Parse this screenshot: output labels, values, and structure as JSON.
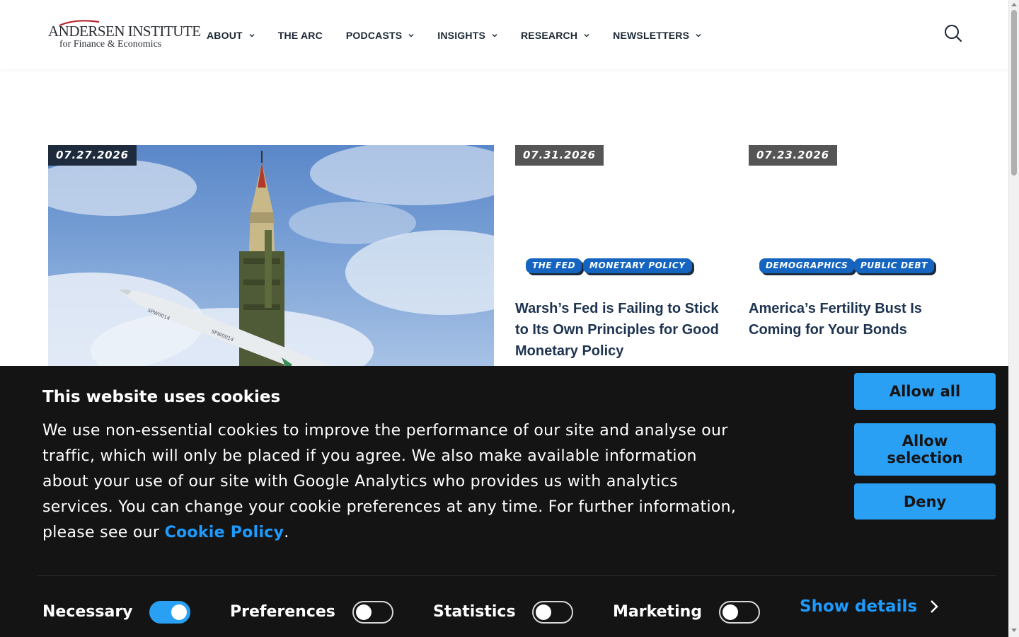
{
  "header": {
    "logo": {
      "top": "ANDERSEN INSTITUTE",
      "bottom": "for Finance & Economics"
    },
    "nav": [
      {
        "label": "ABOUT",
        "has_dropdown": true
      },
      {
        "label": "THE ARC",
        "has_dropdown": false
      },
      {
        "label": "PODCASTS",
        "has_dropdown": true
      },
      {
        "label": "INSIGHTS",
        "has_dropdown": true
      },
      {
        "label": "RESEARCH",
        "has_dropdown": true
      },
      {
        "label": "NEWSLETTERS",
        "has_dropdown": true
      }
    ],
    "search_icon": "search-icon"
  },
  "articles": [
    {
      "date": "07.27.2026",
      "image": "missile-launcher-photo",
      "tags": [],
      "title": ""
    },
    {
      "date": "07.31.2026",
      "tags": [
        "THE FED",
        "MONETARY POLICY"
      ],
      "title": "Warsh’s Fed is Failing to Stick to Its Own Principles for Good Monetary Policy"
    },
    {
      "date": "07.23.2026",
      "tags": [
        "DEMOGRAPHICS",
        "PUBLIC DEBT"
      ],
      "title": "America’s Fertility Bust Is Coming for Your Bonds"
    }
  ],
  "cookie_banner": {
    "title": "This website uses cookies",
    "text_before_link": "We use non-essential cookies to improve the performance of our site and analyse our traffic, which will only be placed if you agree. We also make available information about your use of our site with Google Analytics who provides us with analytics services. You can change your cookie preferences at any time. For further information, please see our ",
    "link_label": "Cookie Policy",
    "text_after_link": ".",
    "buttons": {
      "allow_all": "Allow all",
      "allow_selection": "Allow selection",
      "deny": "Deny"
    },
    "controls": [
      {
        "label": "Necessary",
        "enabled": true
      },
      {
        "label": "Preferences",
        "enabled": false
      },
      {
        "label": "Statistics",
        "enabled": false
      },
      {
        "label": "Marketing",
        "enabled": false
      }
    ],
    "show_details": "Show details"
  },
  "colors": {
    "accent_blue": "#2aa0f5",
    "link_blue": "#1e9bff",
    "tag_blue": "#1565c0",
    "navy": "#1d2b3c",
    "banner_bg": "#141414"
  }
}
